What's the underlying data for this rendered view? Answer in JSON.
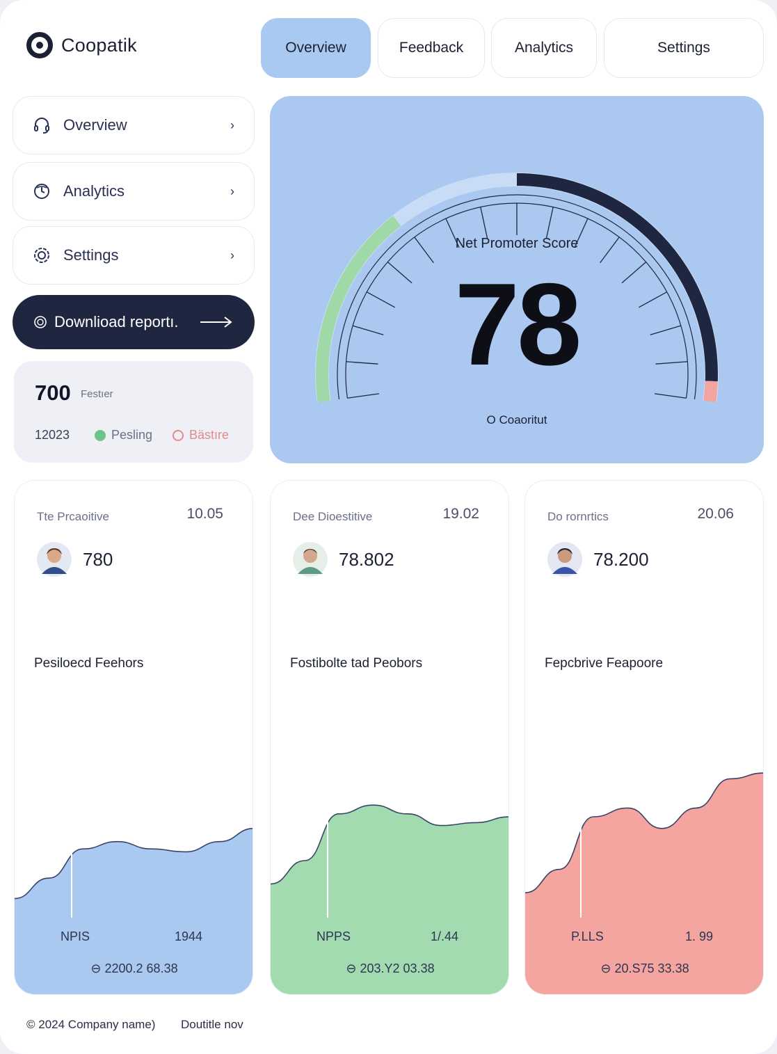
{
  "app": {
    "name": "Coopatik"
  },
  "tabs": [
    {
      "label": "Overview",
      "active": true
    },
    {
      "label": "Feedback",
      "active": false
    },
    {
      "label": "Analytics",
      "active": false
    },
    {
      "label": "Settings",
      "active": false
    }
  ],
  "sidebar": {
    "items": [
      {
        "label": "Overview",
        "icon": "headset-icon"
      },
      {
        "label": "Analytics",
        "icon": "clock-icon"
      },
      {
        "label": "Settings",
        "icon": "gear-icon"
      }
    ],
    "download": {
      "label": "Downlioad reportı.",
      "icon": "download-icon"
    }
  },
  "summary": {
    "value": "700",
    "tag": "Festıer",
    "year": "12023",
    "legend_pos": "Pesling",
    "legend_neg": "Bästıre",
    "colors": {
      "pos": "#6cc48a",
      "neg": "#e88a8a"
    }
  },
  "gauge": {
    "label": "Net Promoter Score",
    "value": "78",
    "score": 78,
    "footer": "O  Coaoritut",
    "colors": {
      "panel": "#aac8f0",
      "green": "#9fd9a8",
      "dark": "#1f2640",
      "pink": "#f3a4a0",
      "light": "#c9dcf6"
    }
  },
  "metrics": [
    {
      "title": "Tte Prcaoitive",
      "num": "10.05",
      "value": "780",
      "subtitle": "Pesiloecd Feehors",
      "foot_left": "NPIS",
      "foot_right": "1944",
      "foot_center": "⊖ 2200.2 68.38",
      "color": "#a9c9f0",
      "chart_data": {
        "type": "area",
        "x": [
          0,
          1,
          2,
          3,
          4,
          5,
          6,
          7
        ],
        "values": [
          14,
          28,
          48,
          53,
          48,
          46,
          53,
          62
        ]
      }
    },
    {
      "title": "Dee Dioestitive",
      "num": "19.02",
      "value": "78.802",
      "subtitle": "Fostibolte tad Peobors",
      "foot_left": "NPPS",
      "foot_right": "1/.44",
      "foot_center": "⊖ 203.Y2 03.38",
      "color": "#a2dbb0",
      "chart_data": {
        "type": "area",
        "x": [
          0,
          1,
          2,
          3,
          4,
          5,
          6,
          7
        ],
        "values": [
          24,
          40,
          72,
          78,
          72,
          64,
          66,
          70
        ]
      }
    },
    {
      "title": "Do rornrtics",
      "num": "20.06",
      "value": "78.200",
      "subtitle": "Fepcbrive Feapoore",
      "foot_left": "P.LLS",
      "foot_right": "1. 99",
      "foot_center": "⊖ 20.S75 33.38",
      "color": "#f4a5a0",
      "chart_data": {
        "type": "area",
        "x": [
          0,
          1,
          2,
          3,
          4,
          5,
          6,
          7
        ],
        "values": [
          18,
          34,
          70,
          76,
          62,
          76,
          96,
          100
        ]
      }
    }
  ],
  "footer": {
    "copyright": "© 2024 Company name)",
    "link": "Doutitle nov"
  }
}
